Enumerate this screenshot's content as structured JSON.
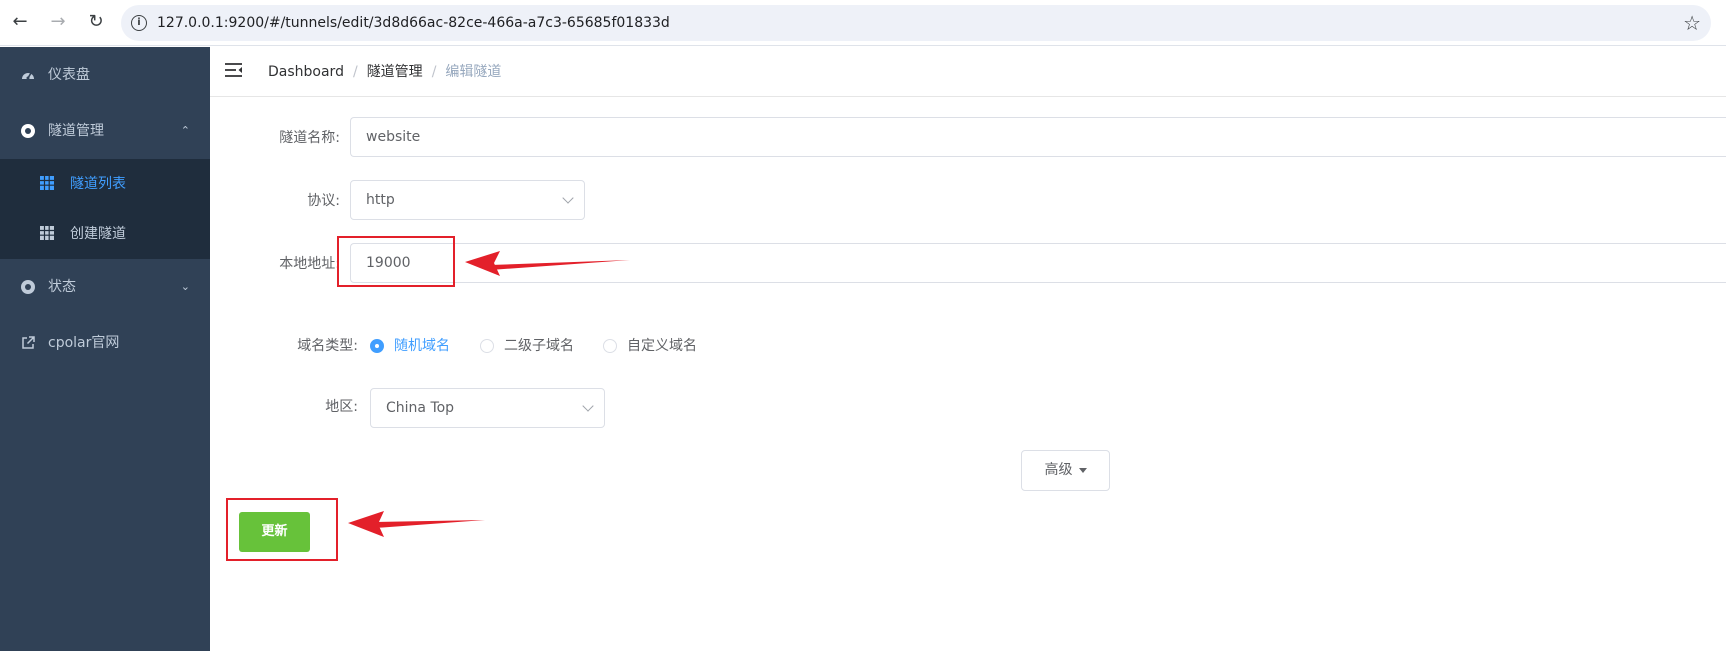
{
  "browser": {
    "url": "127.0.0.1:9200/#/tunnels/edit/3d8d66ac-82ce-466a-a7c3-65685f01833d"
  },
  "sidebar": {
    "items": [
      {
        "label": "仪表盘",
        "icon": "dashboard-icon"
      },
      {
        "label": "隧道管理",
        "icon": "tunnel-icon",
        "expanded": true,
        "children": [
          {
            "label": "隧道列表",
            "icon": "table-icon",
            "active": true
          },
          {
            "label": "创建隧道",
            "icon": "table-icon",
            "active": false
          }
        ]
      },
      {
        "label": "状态",
        "icon": "status-icon",
        "expanded": false
      },
      {
        "label": "cpolar官网",
        "icon": "external-link-icon"
      }
    ]
  },
  "breadcrumb": [
    "Dashboard",
    "隧道管理",
    "编辑隧道"
  ],
  "form": {
    "name_label": "隧道名称:",
    "name_value": "website",
    "protocol_label": "协议:",
    "protocol_value": "http",
    "local_label": "本地地址:",
    "local_value": "19000",
    "domain_type_label": "域名类型:",
    "domain_types": [
      "随机域名",
      "二级子域名",
      "自定义域名"
    ],
    "domain_type_selected": "随机域名",
    "region_label": "地区:",
    "region_value": "China Top",
    "advanced_label": "高级",
    "submit_label": "更新"
  },
  "colors": {
    "sidebar_bg": "#304156",
    "submenu_bg": "#1f2d3d",
    "active": "#409eff",
    "submit": "#67c23a",
    "annotation": "#e3202a"
  }
}
